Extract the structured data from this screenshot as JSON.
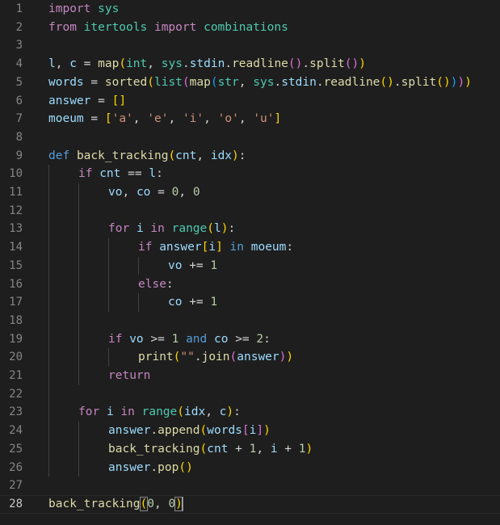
{
  "editor": {
    "language": "python",
    "active_line": 28,
    "colors": {
      "background": "#1e1e1e",
      "keyword": "#569cd6",
      "control": "#c586c0",
      "variable": "#9cdcfe",
      "function": "#dcdcaa",
      "module": "#4ec9b0",
      "string": "#ce9178",
      "number": "#b5cea8",
      "bracket_level1": "#ffd700",
      "bracket_level2": "#da70d6",
      "bracket_level3": "#179fff",
      "line_number": "#858585"
    },
    "lines": [
      {
        "n": "1",
        "indent": 0,
        "tokens": [
          [
            "kw-ctrl",
            "import"
          ],
          [
            "op",
            " "
          ],
          [
            "cls",
            "sys"
          ]
        ]
      },
      {
        "n": "2",
        "indent": 0,
        "tokens": [
          [
            "ctrl",
            "from"
          ],
          [
            "op",
            " "
          ],
          [
            "cls",
            "itertools"
          ],
          [
            "op",
            " "
          ],
          [
            "ctrl",
            "import"
          ],
          [
            "op",
            " "
          ],
          [
            "cls",
            "combinations"
          ]
        ]
      },
      {
        "n": "3",
        "indent": 0,
        "tokens": []
      },
      {
        "n": "4",
        "indent": 0,
        "tokens": [
          [
            "var",
            "l"
          ],
          [
            "op",
            ", "
          ],
          [
            "var",
            "c"
          ],
          [
            "op",
            " = "
          ],
          [
            "fn",
            "map"
          ],
          [
            "p1",
            "("
          ],
          [
            "cls",
            "int"
          ],
          [
            "op",
            ", "
          ],
          [
            "cls",
            "sys"
          ],
          [
            "op",
            "."
          ],
          [
            "var",
            "stdin"
          ],
          [
            "op",
            "."
          ],
          [
            "fn",
            "readline"
          ],
          [
            "p2",
            "("
          ],
          [
            "p2",
            ")"
          ],
          [
            "op",
            "."
          ],
          [
            "fn",
            "split"
          ],
          [
            "p2",
            "("
          ],
          [
            "p2",
            ")"
          ],
          [
            "p1",
            ")"
          ]
        ]
      },
      {
        "n": "5",
        "indent": 0,
        "tokens": [
          [
            "var",
            "words"
          ],
          [
            "op",
            " = "
          ],
          [
            "fn",
            "sorted"
          ],
          [
            "p1",
            "("
          ],
          [
            "cls",
            "list"
          ],
          [
            "p2",
            "("
          ],
          [
            "fn",
            "map"
          ],
          [
            "p3",
            "("
          ],
          [
            "cls",
            "str"
          ],
          [
            "op",
            ", "
          ],
          [
            "cls",
            "sys"
          ],
          [
            "op",
            "."
          ],
          [
            "var",
            "stdin"
          ],
          [
            "op",
            "."
          ],
          [
            "fn",
            "readline"
          ],
          [
            "p1",
            "("
          ],
          [
            "p1",
            ")"
          ],
          [
            "op",
            "."
          ],
          [
            "fn",
            "split"
          ],
          [
            "p1",
            "("
          ],
          [
            "p1",
            ")"
          ],
          [
            "p3",
            ")"
          ],
          [
            "p2",
            ")"
          ],
          [
            "p1",
            ")"
          ]
        ]
      },
      {
        "n": "6",
        "indent": 0,
        "tokens": [
          [
            "var",
            "answer"
          ],
          [
            "op",
            " = "
          ],
          [
            "p1",
            "[]"
          ]
        ]
      },
      {
        "n": "7",
        "indent": 0,
        "tokens": [
          [
            "var",
            "moeum"
          ],
          [
            "op",
            " = "
          ],
          [
            "p1",
            "["
          ],
          [
            "str",
            "'a'"
          ],
          [
            "op",
            ", "
          ],
          [
            "str",
            "'e'"
          ],
          [
            "op",
            ", "
          ],
          [
            "str",
            "'i'"
          ],
          [
            "op",
            ", "
          ],
          [
            "str",
            "'o'"
          ],
          [
            "op",
            ", "
          ],
          [
            "str",
            "'u'"
          ],
          [
            "p1",
            "]"
          ]
        ]
      },
      {
        "n": "8",
        "indent": 0,
        "tokens": []
      },
      {
        "n": "9",
        "indent": 0,
        "tokens": [
          [
            "kw",
            "def"
          ],
          [
            "op",
            " "
          ],
          [
            "fn",
            "back_tracking"
          ],
          [
            "p1",
            "("
          ],
          [
            "var",
            "cnt"
          ],
          [
            "op",
            ", "
          ],
          [
            "var",
            "idx"
          ],
          [
            "p1",
            ")"
          ],
          [
            "op",
            ":"
          ]
        ]
      },
      {
        "n": "10",
        "indent": 1,
        "tokens": [
          [
            "ctrl",
            "if"
          ],
          [
            "op",
            " "
          ],
          [
            "var",
            "cnt"
          ],
          [
            "op",
            " == "
          ],
          [
            "var",
            "l"
          ],
          [
            "op",
            ":"
          ]
        ]
      },
      {
        "n": "11",
        "indent": 2,
        "tokens": [
          [
            "var",
            "vo"
          ],
          [
            "op",
            ", "
          ],
          [
            "var",
            "co"
          ],
          [
            "op",
            " = "
          ],
          [
            "num",
            "0"
          ],
          [
            "op",
            ", "
          ],
          [
            "num",
            "0"
          ]
        ]
      },
      {
        "n": "12",
        "indent": 2,
        "tokens": []
      },
      {
        "n": "13",
        "indent": 2,
        "tokens": [
          [
            "ctrl",
            "for"
          ],
          [
            "op",
            " "
          ],
          [
            "var",
            "i"
          ],
          [
            "op",
            " "
          ],
          [
            "ctrl",
            "in"
          ],
          [
            "op",
            " "
          ],
          [
            "cls",
            "range"
          ],
          [
            "p1",
            "("
          ],
          [
            "var",
            "l"
          ],
          [
            "p1",
            ")"
          ],
          [
            "op",
            ":"
          ]
        ]
      },
      {
        "n": "14",
        "indent": 3,
        "tokens": [
          [
            "ctrl",
            "if"
          ],
          [
            "op",
            " "
          ],
          [
            "var",
            "answer"
          ],
          [
            "p1",
            "["
          ],
          [
            "var",
            "i"
          ],
          [
            "p1",
            "]"
          ],
          [
            "op",
            " "
          ],
          [
            "kw",
            "in"
          ],
          [
            "op",
            " "
          ],
          [
            "var",
            "moeum"
          ],
          [
            "op",
            ":"
          ]
        ]
      },
      {
        "n": "15",
        "indent": 4,
        "tokens": [
          [
            "var",
            "vo"
          ],
          [
            "op",
            " += "
          ],
          [
            "num",
            "1"
          ]
        ]
      },
      {
        "n": "16",
        "indent": 3,
        "tokens": [
          [
            "ctrl",
            "else"
          ],
          [
            "op",
            ":"
          ]
        ]
      },
      {
        "n": "17",
        "indent": 4,
        "tokens": [
          [
            "var",
            "co"
          ],
          [
            "op",
            " += "
          ],
          [
            "num",
            "1"
          ]
        ]
      },
      {
        "n": "18",
        "indent": 2,
        "tokens": []
      },
      {
        "n": "19",
        "indent": 2,
        "tokens": [
          [
            "ctrl",
            "if"
          ],
          [
            "op",
            " "
          ],
          [
            "var",
            "vo"
          ],
          [
            "op",
            " >= "
          ],
          [
            "num",
            "1"
          ],
          [
            "op",
            " "
          ],
          [
            "kw",
            "and"
          ],
          [
            "op",
            " "
          ],
          [
            "var",
            "co"
          ],
          [
            "op",
            " >= "
          ],
          [
            "num",
            "2"
          ],
          [
            "op",
            ":"
          ]
        ]
      },
      {
        "n": "20",
        "indent": 3,
        "tokens": [
          [
            "fn",
            "print"
          ],
          [
            "p1",
            "("
          ],
          [
            "str",
            "\"\""
          ],
          [
            "op",
            "."
          ],
          [
            "fn",
            "join"
          ],
          [
            "p2",
            "("
          ],
          [
            "var",
            "answer"
          ],
          [
            "p2",
            ")"
          ],
          [
            "p1",
            ")"
          ]
        ]
      },
      {
        "n": "21",
        "indent": 2,
        "tokens": [
          [
            "ctrl",
            "return"
          ]
        ]
      },
      {
        "n": "22",
        "indent": 1,
        "tokens": []
      },
      {
        "n": "23",
        "indent": 1,
        "tokens": [
          [
            "ctrl",
            "for"
          ],
          [
            "op",
            " "
          ],
          [
            "var",
            "i"
          ],
          [
            "op",
            " "
          ],
          [
            "ctrl",
            "in"
          ],
          [
            "op",
            " "
          ],
          [
            "cls",
            "range"
          ],
          [
            "p1",
            "("
          ],
          [
            "var",
            "idx"
          ],
          [
            "op",
            ", "
          ],
          [
            "var",
            "c"
          ],
          [
            "p1",
            ")"
          ],
          [
            "op",
            ":"
          ]
        ]
      },
      {
        "n": "24",
        "indent": 2,
        "tokens": [
          [
            "var",
            "answer"
          ],
          [
            "op",
            "."
          ],
          [
            "fn",
            "append"
          ],
          [
            "p1",
            "("
          ],
          [
            "var",
            "words"
          ],
          [
            "p2",
            "["
          ],
          [
            "var",
            "i"
          ],
          [
            "p2",
            "]"
          ],
          [
            "p1",
            ")"
          ]
        ]
      },
      {
        "n": "25",
        "indent": 2,
        "tokens": [
          [
            "fn",
            "back_tracking"
          ],
          [
            "p1",
            "("
          ],
          [
            "var",
            "cnt"
          ],
          [
            "op",
            " + "
          ],
          [
            "num",
            "1"
          ],
          [
            "op",
            ", "
          ],
          [
            "var",
            "i"
          ],
          [
            "op",
            " + "
          ],
          [
            "num",
            "1"
          ],
          [
            "p1",
            ")"
          ]
        ]
      },
      {
        "n": "26",
        "indent": 2,
        "tokens": [
          [
            "var",
            "answer"
          ],
          [
            "op",
            "."
          ],
          [
            "fn",
            "pop"
          ],
          [
            "p1",
            "("
          ],
          [
            "p1",
            ")"
          ]
        ]
      },
      {
        "n": "27",
        "indent": 0,
        "tokens": []
      },
      {
        "n": "28",
        "indent": 0,
        "tokens": [
          [
            "fn",
            "back_tracking"
          ],
          [
            "p1m",
            "("
          ],
          [
            "num",
            "0"
          ],
          [
            "op",
            ", "
          ],
          [
            "num",
            "0"
          ],
          [
            "p1m",
            ")"
          ],
          [
            "cursor",
            ""
          ]
        ]
      }
    ]
  }
}
